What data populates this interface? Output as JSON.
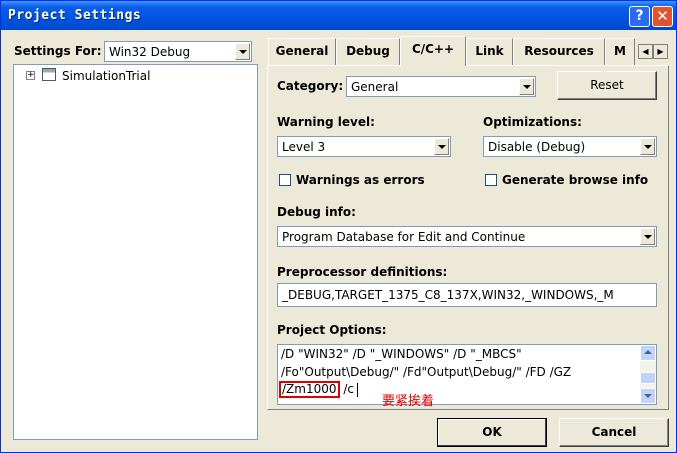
{
  "window": {
    "title": "Project Settings"
  },
  "settings_for": {
    "label": "Settings For:",
    "value": "Win32 Debug"
  },
  "tree": {
    "root_label": "SimulationTrial"
  },
  "tabs": [
    {
      "label": "General"
    },
    {
      "label": "Debug"
    },
    {
      "label": "C/C++"
    },
    {
      "label": "Link"
    },
    {
      "label": "Resources"
    },
    {
      "label": "M"
    }
  ],
  "category": {
    "label": "Category:",
    "value": "General",
    "reset_label": "Reset"
  },
  "warning_level": {
    "label": "Warning level:",
    "value": "Level 3"
  },
  "optimizations": {
    "label": "Optimizations:",
    "value": "Disable (Debug)"
  },
  "warnings_as_errors": {
    "label": "Warnings as errors",
    "checked": false
  },
  "generate_browse": {
    "label": "Generate browse info",
    "checked": false
  },
  "debug_info": {
    "label": "Debug info:",
    "value": "Program Database for Edit and Continue"
  },
  "preprocessor": {
    "label": "Preprocessor definitions:",
    "value": "_DEBUG,TARGET_1375_C8_137X,WIN32,_WINDOWS,_M"
  },
  "project_options": {
    "label": "Project Options:",
    "line1": "/D \"WIN32\" /D \"_WINDOWS\" /D \"_MBCS\"",
    "line2": "/Fo\"Output\\Debug/\" /Fd\"Output\\Debug/\" /FD /GZ",
    "line3_highlight": "/Zm1000",
    "line3_rest": " /c"
  },
  "annotation": {
    "text": "要紧挨着",
    "color": "#e00000"
  },
  "buttons": {
    "ok": "OK",
    "cancel": "Cancel"
  },
  "colors": {
    "titlebar": "#0054e3",
    "face": "#ece9d8",
    "highlight_box": "#e00000"
  }
}
